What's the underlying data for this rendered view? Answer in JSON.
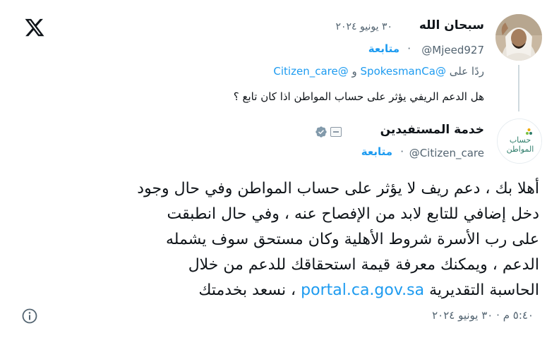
{
  "author": {
    "name": "سبحان الله",
    "date": "٣٠ يونيو ٢٠٢٤",
    "handle": "@Mjeed927",
    "follow_label": "متابعة"
  },
  "reply_to": {
    "prefix": "ردًا على",
    "handle_a": "@SpokesmanCa",
    "conjunction": "و",
    "handle_b": "@Citizen_care"
  },
  "quoted_text": "هل الدعم الريفي يؤثر على حساب المواطن اذا كان تابع ؟",
  "responder": {
    "name": "خدمة المستفيدين",
    "handle": "@Citizen_care",
    "follow_label": "متابعة",
    "logo_line1": "حساب",
    "logo_line2": "المواطن",
    "logo_color": "#2f7d6b",
    "verified_color": "#829aab"
  },
  "tweet": {
    "line1": "أهلا بك ، دعم ريف لا يؤثر على حساب المواطن وفي حال وجود",
    "line2": "دخل إضافي للتابع لابد من الإفصاح عنه ، وفي حال انطبقت",
    "line3": "على رب الأسرة شروط الأهلية وكان مستحق سوف يشمله",
    "line4": "الدعم ، ويمكنك معرفة قيمة استحقاقك للدعم من خلال",
    "line5_text": "الحاسبة التقديرية",
    "link": "portal.ca.gov.sa",
    "line5_tail": "، نسعد بخدمتك"
  },
  "footer": {
    "time": "٥:٤٠ م",
    "separator": "·",
    "date": "٣٠ يونيو ٢٠٢٤"
  },
  "icons": {
    "logo": "x-logo-icon",
    "info": "info-icon",
    "verified": "verified-badge-icon",
    "government": "government-affiliation-icon"
  },
  "colors": {
    "link": "#1d9bf0",
    "secondary_text": "#536471",
    "primary_text": "#0f1419"
  }
}
